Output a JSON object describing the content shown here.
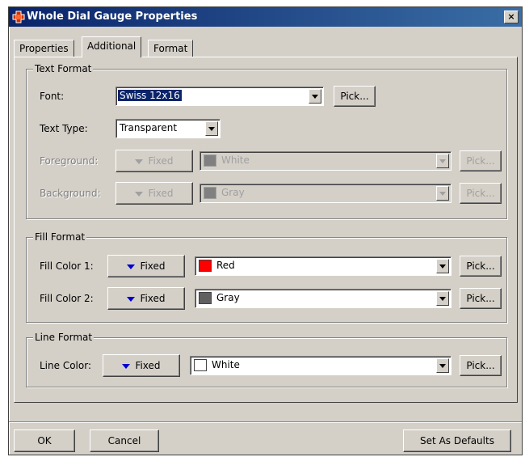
{
  "window": {
    "title": "Whole Dial Gauge Properties",
    "close_label": "×"
  },
  "tabs": [
    {
      "label": "Properties"
    },
    {
      "label": "Additional"
    },
    {
      "label": "Format"
    }
  ],
  "text_format": {
    "title": "Text Format",
    "font_label": "Font:",
    "font_value": "Swiss 12x16",
    "text_type_label": "Text Type:",
    "text_type_value": "Transparent",
    "foreground_label": "Foreground:",
    "foreground_mode": "Fixed",
    "foreground_color": "White",
    "background_label": "Background:",
    "background_mode": "Fixed",
    "background_color": "Gray",
    "pick_label": "Pick..."
  },
  "fill_format": {
    "title": "Fill Format",
    "color1_label": "Fill Color 1:",
    "color1_mode": "Fixed",
    "color1_value": "Red",
    "color2_label": "Fill Color 2:",
    "color2_mode": "Fixed",
    "color2_value": "Gray",
    "pick_label": "Pick..."
  },
  "line_format": {
    "title": "Line Format",
    "color_label": "Line Color:",
    "color_mode": "Fixed",
    "color_value": "White",
    "pick_label": "Pick..."
  },
  "footer": {
    "ok_label": "OK",
    "cancel_label": "Cancel",
    "defaults_label": "Set As Defaults"
  },
  "colors": {
    "red": "#ff0000",
    "gray": "#808080",
    "white": "#ffffff",
    "selection": "#0a246a"
  }
}
